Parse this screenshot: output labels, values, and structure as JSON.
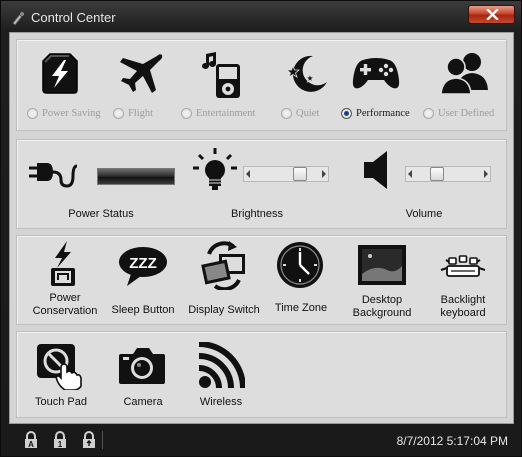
{
  "window": {
    "title": "Control Center"
  },
  "modes": [
    {
      "id": "power-saving",
      "label": "Power Saving",
      "selected": false
    },
    {
      "id": "flight",
      "label": "Flight",
      "selected": false
    },
    {
      "id": "entertainment",
      "label": "Entertainment",
      "selected": false
    },
    {
      "id": "quiet",
      "label": "Quiet",
      "selected": false
    },
    {
      "id": "performance",
      "label": "Performance",
      "selected": true
    },
    {
      "id": "user-defined",
      "label": "User Defined",
      "selected": false
    }
  ],
  "status_panel": {
    "power_status_label": "Power Status",
    "brightness_label": "Brightness",
    "brightness_level": 0.75,
    "volume_label": "Volume",
    "volume_level": 0.3
  },
  "tools": {
    "power_conservation_label": "Power\nConservation",
    "sleep_button_label": "Sleep Button",
    "sleep_icon_text": "ZZZ",
    "display_switch_label": "Display Switch",
    "time_zone_label": "Time Zone",
    "desktop_background_label": "Desktop\nBackground",
    "backlight_keyboard_label": "Backlight\nkeyboard"
  },
  "devices": {
    "touch_pad_label": "Touch Pad",
    "camera_label": "Camera",
    "wireless_label": "Wireless"
  },
  "statusbar": {
    "datetime": "8/7/2012 5:17:04 PM",
    "locks": [
      {
        "name": "caps-lock",
        "letter": "A"
      },
      {
        "name": "num-lock",
        "letter": "1"
      },
      {
        "name": "scroll-lock",
        "letter": ""
      }
    ]
  }
}
